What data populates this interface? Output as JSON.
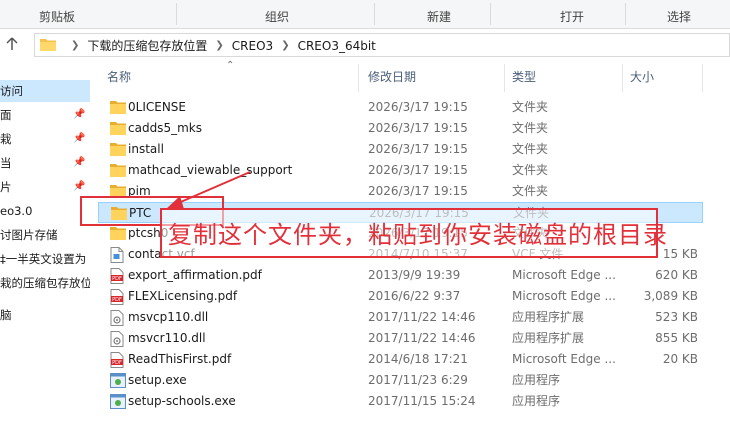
{
  "ribbon": {
    "groups": [
      "剪贴板",
      "组织",
      "新建",
      "打开",
      "选择"
    ]
  },
  "address": {
    "crumbs": [
      "下载的压缩包存放位置",
      "CREO3",
      "CREO3_64bit"
    ]
  },
  "nav": {
    "items": [
      {
        "label": "访问",
        "pinned": false
      },
      {
        "label": "面",
        "pinned": true
      },
      {
        "label": "栽",
        "pinned": true
      },
      {
        "label": "当",
        "pinned": true
      },
      {
        "label": "片",
        "pinned": true
      },
      {
        "label": "eo3.0",
        "pinned": false
      },
      {
        "label": "讨图片存储",
        "pinned": false
      },
      {
        "label": "‡一半英文设置为",
        "pinned": false
      },
      {
        "label": "栽的压缩包存放位",
        "pinned": false
      },
      {
        "label": "脑",
        "pinned": false
      }
    ]
  },
  "columns": {
    "name": "名称",
    "date": "修改日期",
    "type": "类型",
    "size": "大小"
  },
  "files": [
    {
      "name": "0LICENSE",
      "date": "2026/3/17 19:15",
      "type": "文件夹",
      "size": "",
      "icon": "folder-icon"
    },
    {
      "name": "cadds5_mks",
      "date": "2026/3/17 19:15",
      "type": "文件夹",
      "size": "",
      "icon": "folder-icon"
    },
    {
      "name": "install",
      "date": "2026/3/17 19:15",
      "type": "文件夹",
      "size": "",
      "icon": "folder-icon"
    },
    {
      "name": "mathcad_viewable_support",
      "date": "2026/3/17 19:15",
      "type": "文件夹",
      "size": "",
      "icon": "folder-icon"
    },
    {
      "name": "pim",
      "date": "2026/3/17 19:15",
      "type": "文件夹",
      "size": "",
      "icon": "folder-icon"
    },
    {
      "name": "PTC",
      "date": "2026/3/17 19:15",
      "type": "文件夹",
      "size": "",
      "icon": "folder-icon",
      "selected": true
    },
    {
      "name": "ptcsh0",
      "date": "2026/3/17 19:15",
      "type": "文件夹",
      "size": "",
      "icon": "folder-icon"
    },
    {
      "name": "contact.vcf",
      "date": "2014/7/10 15:37",
      "type": "VCF 文件",
      "size": "15 KB",
      "icon": "file-icon"
    },
    {
      "name": "export_affirmation.pdf",
      "date": "2013/9/9 19:39",
      "type": "Microsoft Edge ...",
      "size": "620 KB",
      "icon": "pdf-icon"
    },
    {
      "name": "FLEXLicensing.pdf",
      "date": "2016/6/22 9:37",
      "type": "Microsoft Edge ...",
      "size": "3,089 KB",
      "icon": "pdf-icon"
    },
    {
      "name": "msvcp110.dll",
      "date": "2017/11/22 14:46",
      "type": "应用程序扩展",
      "size": "523 KB",
      "icon": "dll-icon"
    },
    {
      "name": "msvcr110.dll",
      "date": "2017/11/22 14:46",
      "type": "应用程序扩展",
      "size": "855 KB",
      "icon": "dll-icon"
    },
    {
      "name": "ReadThisFirst.pdf",
      "date": "2014/6/18 17:21",
      "type": "Microsoft Edge ...",
      "size": "20 KB",
      "icon": "pdf-icon"
    },
    {
      "name": "setup.exe",
      "date": "2017/11/23 6:29",
      "type": "应用程序",
      "size": "",
      "icon": "exe-icon"
    },
    {
      "name": "setup-schools.exe",
      "date": "2017/11/15 15:24",
      "type": "应用程序",
      "size": "",
      "icon": "exe-icon"
    }
  ],
  "annotation": {
    "text": "复制这个文件夹，粘贴到你安装磁盘的根目录",
    "color": "#e2303a"
  },
  "colors": {
    "folder": "#f5c24d",
    "selection": "#cce8ff",
    "header_text": "#4c607a"
  }
}
